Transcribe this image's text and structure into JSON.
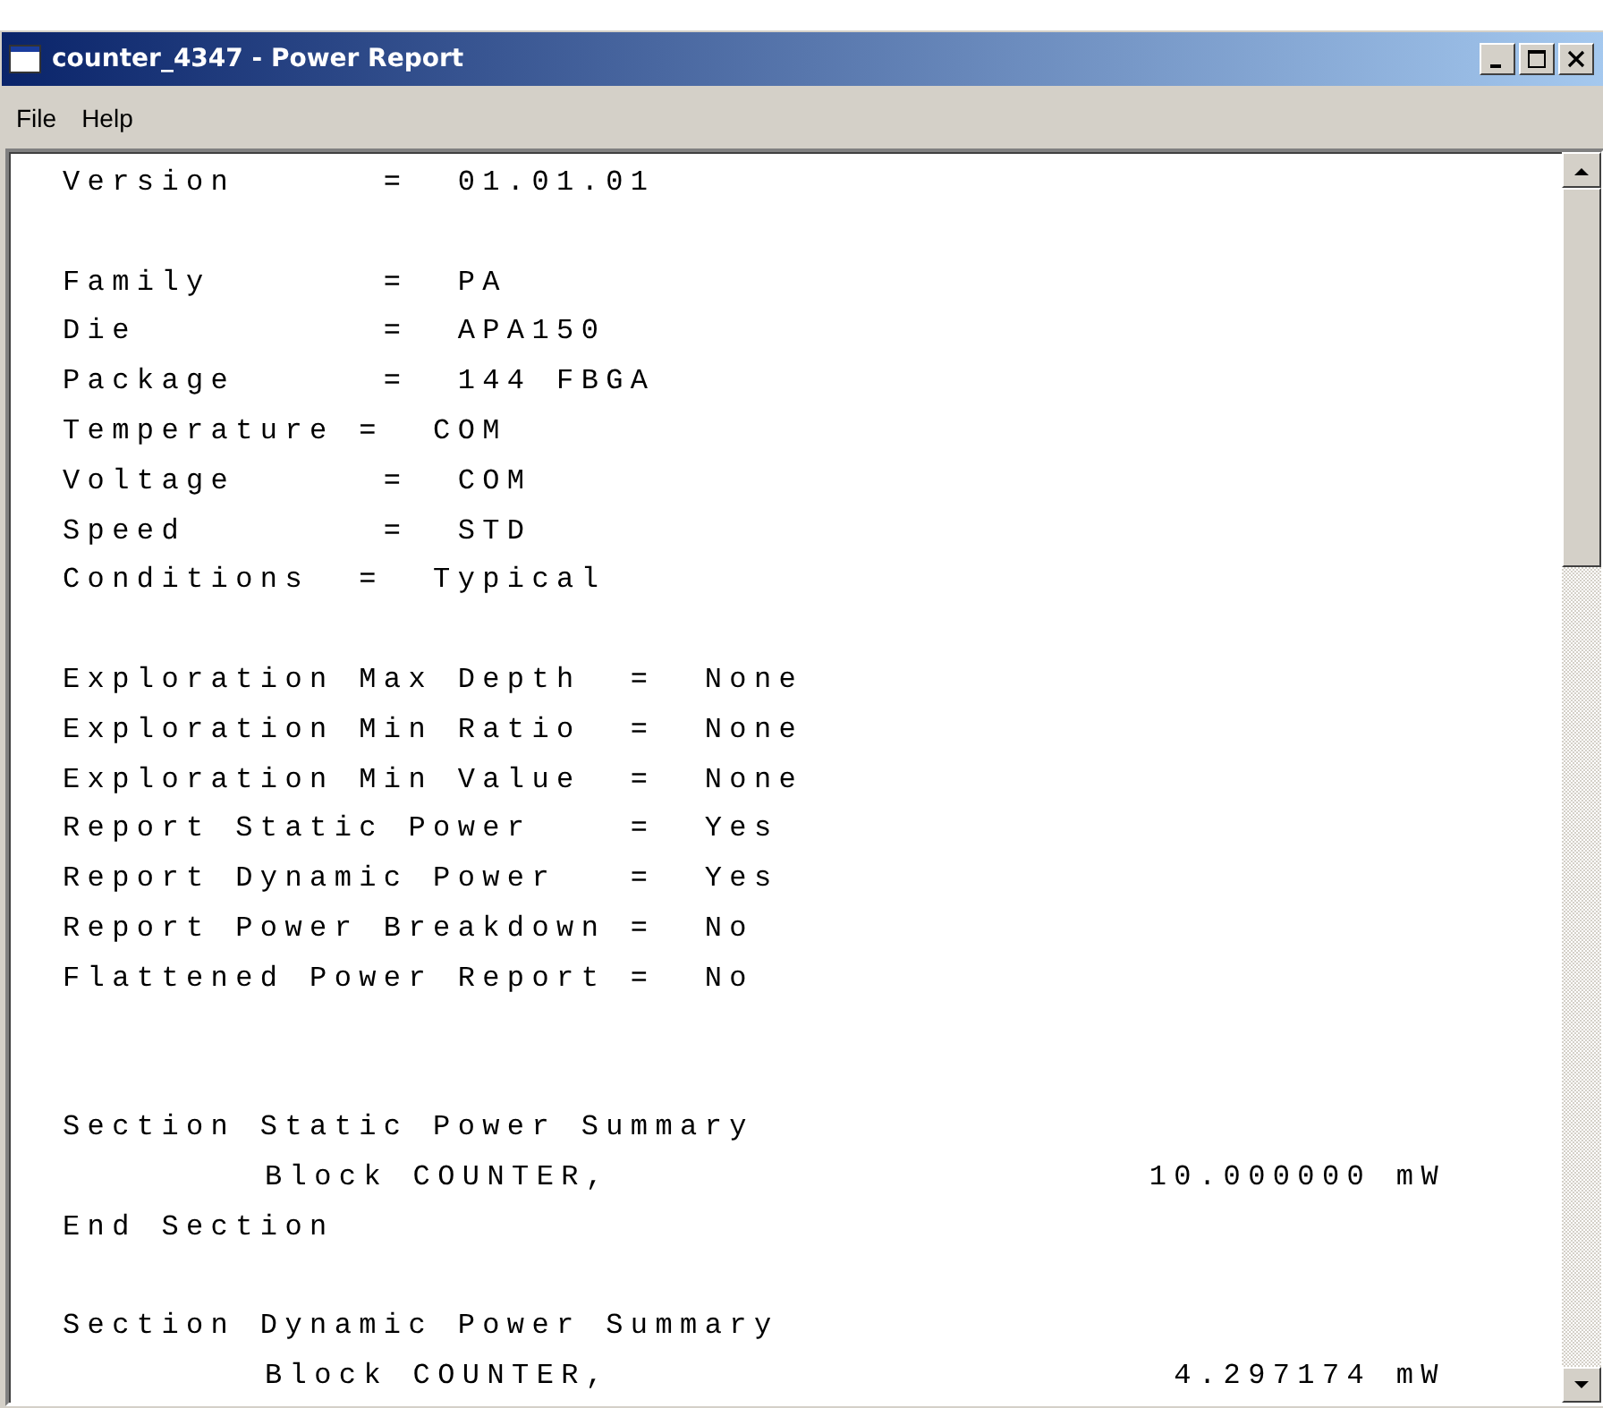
{
  "window": {
    "title": "counter_4347 - Power Report"
  },
  "menu": [
    "File",
    "Help"
  ],
  "report_lines": [
    {
      "kind": "text",
      "text": "Version      =  01.01.01"
    },
    {
      "kind": "blank"
    },
    {
      "kind": "text",
      "text": "Family       =  PA"
    },
    {
      "kind": "text",
      "text": "Die          =  APA150"
    },
    {
      "kind": "text",
      "text": "Package      =  144 FBGA"
    },
    {
      "kind": "text",
      "text": "Temperature =  COM"
    },
    {
      "kind": "text",
      "text": "Voltage      =  COM"
    },
    {
      "kind": "text",
      "text": "Speed        =  STD"
    },
    {
      "kind": "text",
      "text": "Conditions  =  Typical"
    },
    {
      "kind": "blank"
    },
    {
      "kind": "text",
      "text": "Exploration Max Depth  =  None"
    },
    {
      "kind": "text",
      "text": "Exploration Min Ratio  =  None"
    },
    {
      "kind": "text",
      "text": "Exploration Min Value  =  None"
    },
    {
      "kind": "text",
      "text": "Report Static Power    =  Yes"
    },
    {
      "kind": "text",
      "text": "Report Dynamic Power   =  Yes"
    },
    {
      "kind": "text",
      "text": "Report Power Breakdown =  No"
    },
    {
      "kind": "text",
      "text": "Flattened Power Report =  No"
    },
    {
      "kind": "blank"
    },
    {
      "kind": "blank"
    },
    {
      "kind": "text",
      "text": "Section Static Power Summary"
    },
    {
      "kind": "block",
      "label": "Block COUNTER,",
      "value": "10.000000 mW"
    },
    {
      "kind": "text",
      "text": "End Section"
    },
    {
      "kind": "blank"
    },
    {
      "kind": "text",
      "text": "Section Dynamic Power Summary"
    },
    {
      "kind": "block",
      "label": "Block COUNTER,",
      "value": "4.297174 mW"
    }
  ]
}
